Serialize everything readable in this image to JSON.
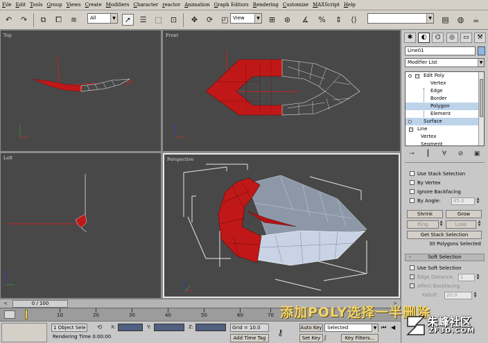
{
  "menu": [
    "File",
    "Edit",
    "Tools",
    "Group",
    "Views",
    "Create",
    "Modifiers",
    "Character",
    "reactor",
    "Animation",
    "Graph Editors",
    "Rendering",
    "Customize",
    "MAXScript",
    "Help"
  ],
  "toolbar": {
    "selection_filter": "All",
    "coord_system": "View",
    "icons": [
      "undo-icon",
      "redo-icon",
      "link-icon",
      "unlink-icon",
      "bind-spacewarp-icon",
      "select-icon",
      "select-by-name-icon",
      "region-select-icon",
      "window-crossing-icon",
      "move-icon",
      "rotate-icon",
      "scale-icon",
      "pivot-icon",
      "snap-icon",
      "angle-snap-icon",
      "percent-snap-icon",
      "spinner-snap-icon",
      "mirror-icon"
    ]
  },
  "viewports": {
    "top": "Top",
    "front": "Front",
    "left": "Left",
    "perspective": "Perspective"
  },
  "command_panel": {
    "object_name": "Line01",
    "modifier_list": "Modifier List",
    "stack": [
      {
        "label": "Edit Poly",
        "level": 0,
        "selected": false
      },
      {
        "label": "Vertex",
        "level": 1,
        "selected": false
      },
      {
        "label": "Edge",
        "level": 1,
        "selected": false
      },
      {
        "label": "Border",
        "level": 1,
        "selected": false
      },
      {
        "label": "Polygon",
        "level": 1,
        "selected": true
      },
      {
        "label": "Element",
        "level": 1,
        "selected": false
      },
      {
        "label": "Surface",
        "level": 0,
        "selected": false
      },
      {
        "label": "Line",
        "level": 0,
        "selected": false
      },
      {
        "label": "Vertex",
        "level": 1,
        "selected": false
      },
      {
        "label": "Segment",
        "level": 1,
        "selected": false
      }
    ],
    "selection": {
      "use_stack_selection": "Use Stack Selection",
      "by_vertex": "By Vertex",
      "ignore_backfacing": "Ignore Backfacing",
      "by_angle": "By Angle:",
      "angle_value": "45.0",
      "shrink": "Shrink",
      "grow": "Grow",
      "ring": "Ring",
      "loop": "Loop",
      "get_stack_selection": "Get Stack Selection",
      "status": "30 Polygons Selected"
    },
    "soft_selection": {
      "title": "Soft Selection",
      "use_soft_selection": "Use Soft Selection",
      "edge_distance": "Edge Distance:",
      "edge_distance_value": "1",
      "affect_backfacing": "Affect Backfacing",
      "falloff": "Falloff:",
      "falloff_value": "20.0"
    }
  },
  "timeline": {
    "slider": "0 / 100",
    "ticks": [
      "10",
      "20",
      "30",
      "40",
      "50",
      "60",
      "70"
    ]
  },
  "status_bar": {
    "selected": "1 Object Sele",
    "render_time": "Rendering Time  0:00:00",
    "x_label": "X:",
    "y_label": "Y:",
    "z_label": "Z:",
    "grid": "Grid = 10.0",
    "add_time_tag": "Add Time Tag",
    "auto_key": "Auto Key",
    "set_key": "Set Key",
    "selected_dropdown": "Selected",
    "key_filters": "Key Filters..."
  },
  "caption": "添加POLY选择一半删除",
  "watermark": {
    "cn": "朱峰社区",
    "en": "ZF3D.COM"
  }
}
